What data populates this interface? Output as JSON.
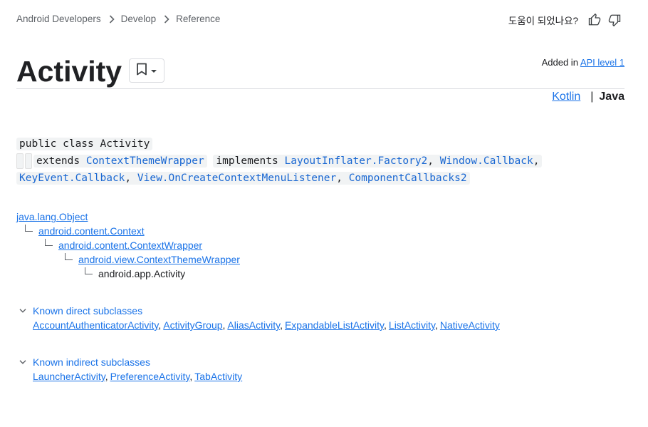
{
  "breadcrumb": [
    "Android Developers",
    "Develop",
    "Reference"
  ],
  "feedback": {
    "label": "도움이 되었나요?"
  },
  "page": {
    "title": "Activity"
  },
  "api_level": {
    "prefix": "Added in",
    "link": "API level 1"
  },
  "language": {
    "options": [
      "Kotlin",
      "Java"
    ],
    "selected": "Java"
  },
  "code": {
    "line1": "public class Activity",
    "extends_kw": "extends",
    "extends_class": "ContextThemeWrapper",
    "implements_kw": "implements",
    "interfaces": [
      "LayoutInflater.Factory2",
      "Window.Callback",
      "KeyEvent.Callback",
      "View.OnCreateContextMenuListener",
      "ComponentCallbacks2"
    ]
  },
  "hierarchy": [
    "java.lang.Object",
    "android.content.Context",
    "android.content.ContextWrapper",
    "android.view.ContextThemeWrapper",
    "android.app.Activity"
  ],
  "subclasses": {
    "direct": {
      "title": "Known direct subclasses",
      "items": [
        "AccountAuthenticatorActivity",
        "ActivityGroup",
        "AliasActivity",
        "ExpandableListActivity",
        "ListActivity",
        "NativeActivity"
      ]
    },
    "indirect": {
      "title": "Known indirect subclasses",
      "items": [
        "LauncherActivity",
        "PreferenceActivity",
        "TabActivity"
      ]
    }
  },
  "colors": {
    "link": "#1a73e8",
    "text": "#202124",
    "code_bg": "#f1f3f4"
  },
  "icons": [
    "chevron-right-icon",
    "thumbs-up-icon",
    "thumbs-down-icon",
    "bookmark-icon",
    "caret-down-icon",
    "chevron-down-icon"
  ]
}
